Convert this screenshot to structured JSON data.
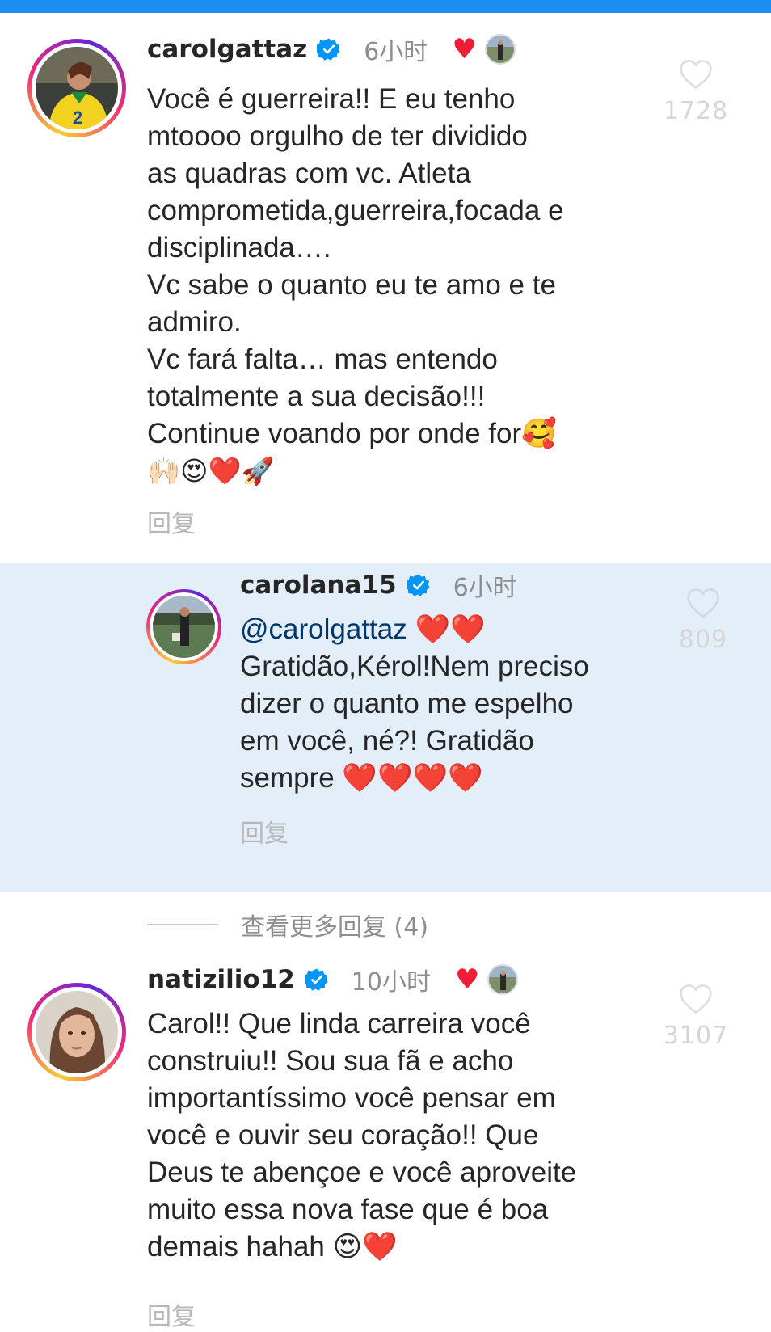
{
  "colors": {
    "accent_bar": "#1e8ff2",
    "reply_highlight": "#e3eef9",
    "verified": "#0095f6",
    "creator_heart": "#ee1d38",
    "mention": "#00376b",
    "muted_text": "#8e8e8e"
  },
  "comments": [
    {
      "username": "carolgattaz",
      "time": "6小时",
      "liked_by_creator": true,
      "body_lines": [
        "Você é guerreira!! E eu tenho",
        "mtoooo orgulho de ter dividido",
        "as quadras com vc. Atleta",
        "comprometida,guerreira,focada e",
        "disciplinada….",
        "Vc sabe o quanto eu te amo e te",
        "admiro.",
        "Vc fará falta… mas entendo",
        "totalmente a sua decisão!!!",
        "Continue voando por onde for🥰",
        "🙌🏻😍❤️🚀"
      ],
      "reply_label": "回复",
      "like_count": "1728"
    },
    {
      "username": "carolana15",
      "time": "6小时",
      "mention": "@carolgattaz",
      "mention_suffix": " ❤️❤️",
      "body_lines": [
        "Gratidão,Kérol!Nem preciso",
        "dizer o quanto me espelho",
        "em você, né?! Gratidão",
        "sempre ❤️❤️❤️❤️"
      ],
      "reply_label": "回复",
      "like_count": "809"
    },
    {
      "username": "natizilio12",
      "time": "10小时",
      "liked_by_creator": true,
      "body_lines": [
        "Carol!! Que linda carreira você",
        "construiu!! Sou sua fã e acho",
        "importantíssimo você pensar em",
        "você e ouvir seu coração!! Que",
        "Deus te abençoe e você aproveite",
        "muito essa nova fase que é boa",
        "demais hahah 😍❤️"
      ],
      "reply_label": "回复",
      "like_count": "3107"
    }
  ],
  "view_more_replies": "查看更多回复 (4)",
  "icons": {
    "verified": "verified-badge-icon",
    "like": "heart-outline-icon",
    "creator_like": "heart-filled-icon"
  }
}
